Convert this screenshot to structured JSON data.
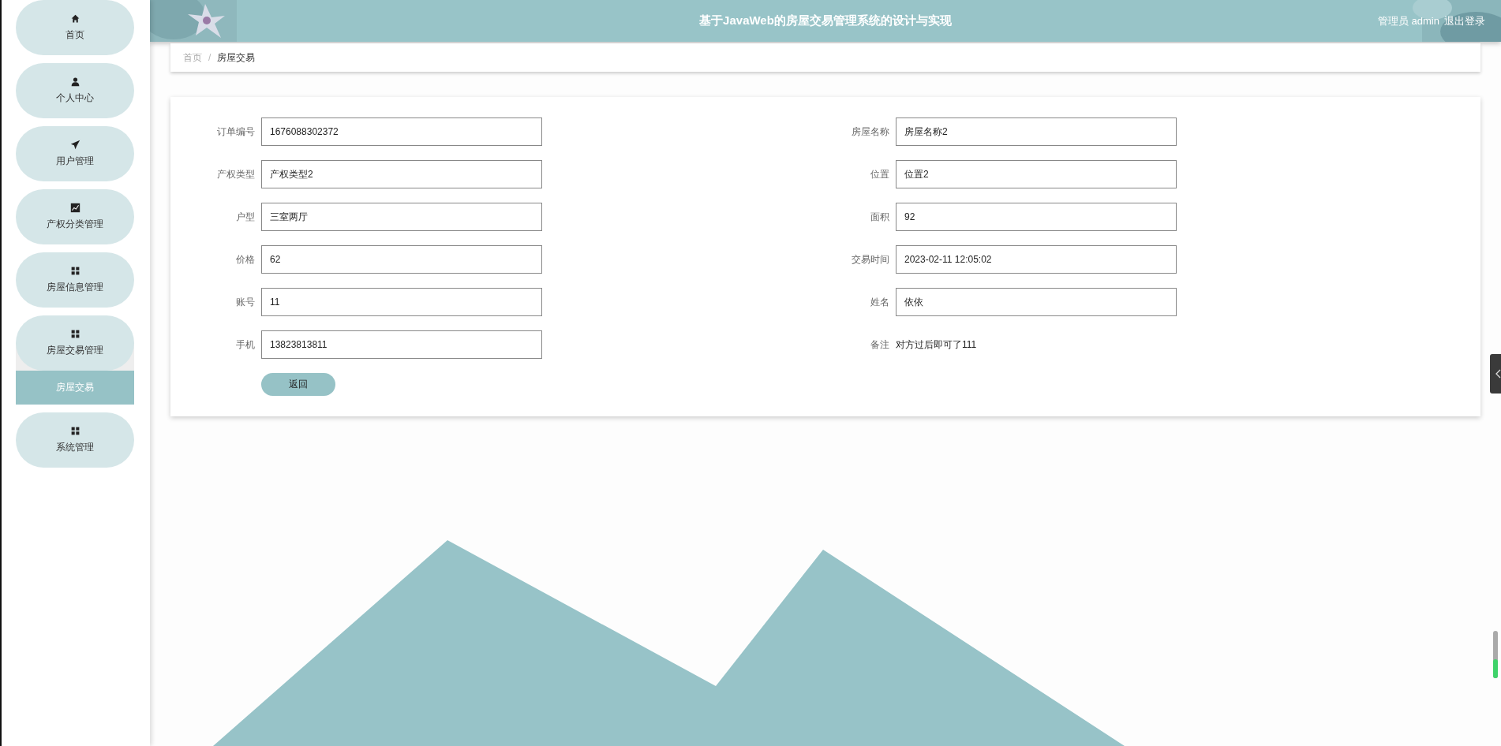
{
  "header": {
    "title": "基于JavaWeb的房屋交易管理系统的设计与实现",
    "user": "管理员 admin",
    "logout": "退出登录"
  },
  "sidebar": {
    "items": [
      {
        "label": "首页",
        "selected": false
      },
      {
        "label": "个人中心",
        "selected": false
      },
      {
        "label": "用户管理",
        "selected": false
      },
      {
        "label": "产权分类管理",
        "selected": false
      },
      {
        "label": "房屋信息管理",
        "selected": false
      },
      {
        "label": "房屋交易管理",
        "selected": false,
        "children": [
          {
            "label": "房屋交易",
            "selected": true
          }
        ]
      },
      {
        "label": "系统管理",
        "selected": false
      }
    ]
  },
  "breadcrumb": [
    {
      "label": "首页"
    },
    {
      "label": "房屋交易"
    }
  ],
  "breadcrumb_separator": "/",
  "form": {
    "fields": [
      {
        "label": "订单编号",
        "value": "1676088302372",
        "kind": "input"
      },
      {
        "label": "房屋名称",
        "value": "房屋名称2",
        "kind": "input"
      },
      {
        "label": "产权类型",
        "value": "产权类型2",
        "kind": "input"
      },
      {
        "label": "位置",
        "value": "位置2",
        "kind": "input"
      },
      {
        "label": "户型",
        "value": "三室两厅",
        "kind": "input"
      },
      {
        "label": "面积",
        "value": "92",
        "kind": "input"
      },
      {
        "label": "价格",
        "value": "62",
        "kind": "input"
      },
      {
        "label": "交易时间",
        "value": "2023-02-11 12:05:02",
        "kind": "input"
      },
      {
        "label": "账号",
        "value": "11",
        "kind": "input"
      },
      {
        "label": "姓名",
        "value": "依依",
        "kind": "input"
      },
      {
        "label": "手机",
        "value": "13823813811",
        "kind": "input"
      },
      {
        "label": "备注",
        "value": "对方过后即可了111",
        "kind": "text"
      }
    ],
    "button": "返回"
  }
}
